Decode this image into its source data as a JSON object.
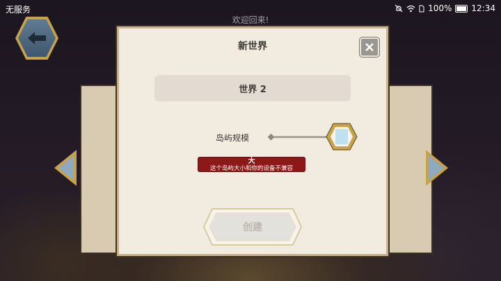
{
  "status_bar": {
    "carrier": "无服务",
    "battery": "100%",
    "time": "12:34"
  },
  "header": {
    "welcome": "欢迎回来!"
  },
  "dialog": {
    "title": "新世界",
    "world_name": "世界 2",
    "island_size_label": "岛屿规模",
    "island_size_level": 1.0,
    "warning_size": "大",
    "warning_message": "这个岛屿大小和你的设备不兼容",
    "create_label": "创建"
  },
  "icons": {
    "back": "back-arrow-icon",
    "close": "close-icon",
    "prev": "left-arrow-icon",
    "next": "right-arrow-icon"
  },
  "colors": {
    "warning_bg": "#8d1818",
    "panel_bg": "#f1ebe0",
    "gold_frame": "#c8a24a"
  }
}
